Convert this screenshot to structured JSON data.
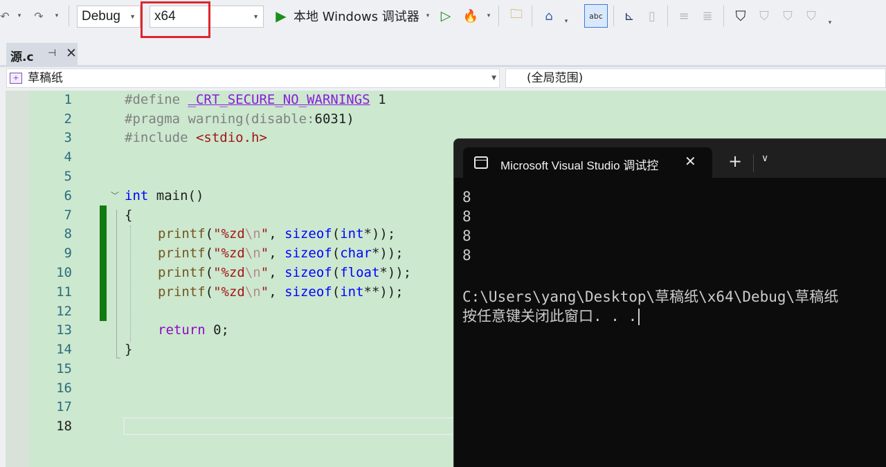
{
  "toolbar": {
    "config": "Debug",
    "platform": "x64",
    "run_label": "本地 Windows 调试器",
    "highlight_color": "#e0242b"
  },
  "tab": {
    "name": "源.c",
    "pin": "⊣",
    "close": "✕"
  },
  "navbar": {
    "project": "草稿纸",
    "scope": "(全局范围)"
  },
  "editor": {
    "line_numbers": [
      "1",
      "2",
      "3",
      "4",
      "5",
      "6",
      "7",
      "8",
      "9",
      "10",
      "11",
      "12",
      "13",
      "14",
      "15",
      "16",
      "17",
      "18"
    ],
    "current_line": "18",
    "lines": {
      "l1_a": "#define ",
      "l1_b": "_CRT_SECURE_NO_WARNINGS",
      "l1_c": " 1",
      "l2_a": "#pragma warning(disable:",
      "l2_b": "6031",
      "l2_c": ")",
      "l3_a": "#include ",
      "l3_b": "<stdio.h>",
      "l6_a": "int",
      "l6_b": " main()",
      "l7": "{",
      "printf": "printf",
      "open": "(",
      "str_a": "\"%zd",
      "str_esc": "\\n",
      "str_b": "\"",
      "comma": ", ",
      "sizeof": "sizeof",
      "l8_type": "int",
      "l8_rest": "*));",
      "l9_type": "char",
      "l9_rest": "*));",
      "l10_type": "float",
      "l10_rest": "*));",
      "l11_type": "int",
      "l11_rest": "**));",
      "l13_kw": "return",
      "l13_rest": " 0;",
      "l14": "}"
    }
  },
  "console": {
    "title": "Microsoft Visual Studio 调试控",
    "close": "✕",
    "new_tab": "+",
    "dropdown": "∨",
    "output": [
      "8",
      "8",
      "8",
      "8"
    ],
    "path_line": "C:\\Users\\yang\\Desktop\\草稿纸\\x64\\Debug\\草稿纸",
    "prompt_line": "按任意键关闭此窗口. . ."
  }
}
